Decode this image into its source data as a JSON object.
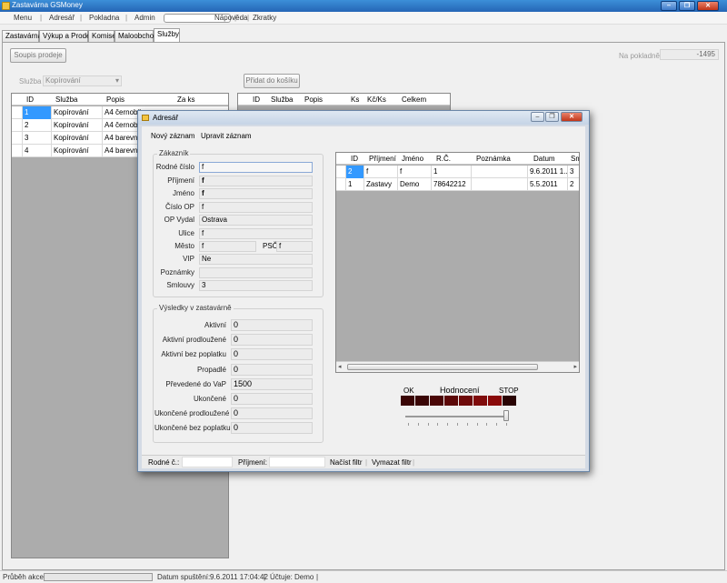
{
  "app": {
    "title": "Zastavárna GSMoney"
  },
  "menu": [
    "Menu",
    "Adresář",
    "Pokladna",
    "Admin",
    "Nápověda",
    "Zkratky"
  ],
  "tabs": [
    "Zastavárna",
    "Výkup a Prodej",
    "Komise",
    "Maloobchod",
    "Služby"
  ],
  "services": {
    "summary_button": "Soupis prodeje",
    "cash_label": "Na pokladně",
    "cash_value": "-1495",
    "service_label": "Služba",
    "service_value": "Kopírování",
    "add_to_cart_button": "Přidat do košíku",
    "left_grid": {
      "columns": [
        "ID",
        "Služba",
        "Popis",
        "Za ks"
      ],
      "rows": [
        [
          "1",
          "Kopírování",
          "A4 černobile"
        ],
        [
          "2",
          "Kopírování",
          "A4 černobile"
        ],
        [
          "3",
          "Kopírování",
          "A4 barevně"
        ],
        [
          "4",
          "Kopírování",
          "A4 barevně"
        ]
      ]
    },
    "cart_grid": {
      "columns": [
        "ID",
        "Služba",
        "Popis",
        "Ks",
        "Kč/Ks",
        "Celkem"
      ]
    }
  },
  "status": {
    "progress_label": "Průběh akce",
    "started_label": "Datum spuštění:",
    "started_value": "9.6.2011 17:04:42",
    "accounts_label": "Účtuje:",
    "accounts_value": "Demo"
  },
  "dialog": {
    "title": "Adresář",
    "menu": [
      "Nový záznam",
      "Upravit záznam"
    ],
    "customer_group": "Zákazník",
    "customer_fields": [
      {
        "label": "Rodné číslo",
        "value": "f"
      },
      {
        "label": "Příjmení",
        "value": "f"
      },
      {
        "label": "Jméno",
        "value": "f"
      },
      {
        "label": "Číslo OP",
        "value": "f"
      },
      {
        "label": "OP Vydal",
        "value": "Ostrava"
      },
      {
        "label": "Ulice",
        "value": "f"
      },
      {
        "label": "Město",
        "value": "f"
      },
      {
        "label": "VIP",
        "value": "Ne"
      },
      {
        "label": "Poznámky",
        "value": ""
      },
      {
        "label": "Smlouvy",
        "value": "3"
      }
    ],
    "psc_label": "PSČ",
    "psc_value": "f",
    "results_group": "Výsledky v zastavárně",
    "results_fields": [
      {
        "label": "Aktivní",
        "value": "0"
      },
      {
        "label": "Aktivní prodloužené",
        "value": "0"
      },
      {
        "label": "Aktivní bez poplatku",
        "value": "0"
      },
      {
        "label": "Propadlé",
        "value": "0"
      },
      {
        "label": "Převedené do VaP",
        "value": "1500"
      },
      {
        "label": "Ukončené",
        "value": "0"
      },
      {
        "label": "Ukončené prodloužené",
        "value": "0"
      },
      {
        "label": "Ukončené bez poplatku",
        "value": "0"
      }
    ],
    "grid": {
      "columns": [
        "ID",
        "Příjmení",
        "Jméno",
        "R.Č.",
        "Poznámka",
        "Datum",
        "Sm"
      ],
      "rows": [
        [
          "2",
          "f",
          "f",
          "1",
          "",
          "9.6.2011 1...",
          "3"
        ],
        [
          "1",
          "Zastavy",
          "Demo",
          "78642212",
          "",
          "5.5.2011",
          "2"
        ]
      ]
    },
    "rating": {
      "ok": "OK",
      "label": "Hodnocení",
      "stop": "STOP",
      "colors": [
        "#3a0606",
        "#3a0606",
        "#4a0606",
        "#5c0808",
        "#6e0a0a",
        "#800c0c",
        "#8a0a0a",
        "#2a0404"
      ],
      "level": 1.0
    },
    "filter": {
      "rc_label": "Rodné č.:",
      "surname_label": "Příjmení:",
      "load_button": "Načíst filtr",
      "clear_button": "Vymazat filtr"
    }
  }
}
